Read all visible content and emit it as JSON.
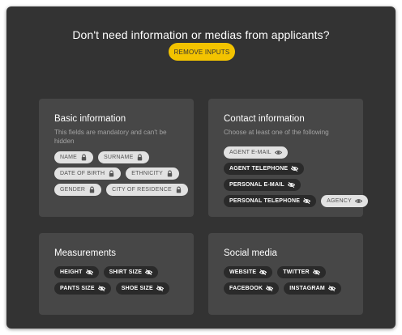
{
  "header": {
    "title": "Don't need information or medias from applicants?",
    "remove_button": "REMOVE INPUTS"
  },
  "colors": {
    "window_bg": "#333333",
    "card_bg": "#474747",
    "accent": "#f3c300",
    "chip_light": "#e2e2e2",
    "chip_dark": "#2a2a2a"
  },
  "basic": {
    "title": "Basic information",
    "subtitle_line1": "This fields are mandatory and can't be",
    "subtitle_line2": "hidden",
    "chips": [
      {
        "label": "NAME",
        "icon": "lock-icon"
      },
      {
        "label": "SURNAME",
        "icon": "lock-icon"
      },
      {
        "label": "DATE OF BIRTH",
        "icon": "lock-icon"
      },
      {
        "label": "ETHNICITY",
        "icon": "lock-icon"
      },
      {
        "label": "GENDER",
        "icon": "lock-icon"
      },
      {
        "label": "CITY OF RESIDENCE",
        "icon": "lock-icon"
      }
    ]
  },
  "contact": {
    "title": "Contact information",
    "subtitle": "Choose at least one of the following",
    "chips": [
      {
        "label": "AGENT E-MAIL",
        "icon": "eye-icon"
      },
      {
        "label": "AGENT TELEPHONE",
        "icon": "eye-slash-icon"
      },
      {
        "label": "PERSONAL E-MAIL",
        "icon": "eye-slash-icon"
      },
      {
        "label": "PERSONAL TELEPHONE",
        "icon": "eye-slash-icon"
      },
      {
        "label": "AGENCY",
        "icon": "eye-icon"
      }
    ]
  },
  "measurements": {
    "title": "Measurements",
    "chips": [
      {
        "label": "HEIGHT",
        "icon": "eye-slash-icon"
      },
      {
        "label": "SHIRT SIZE",
        "icon": "eye-slash-icon"
      },
      {
        "label": "PANTS SIZE",
        "icon": "eye-slash-icon"
      },
      {
        "label": "SHOE SIZE",
        "icon": "eye-slash-icon"
      }
    ]
  },
  "social": {
    "title": "Social media",
    "chips": [
      {
        "label": "WEBSITE",
        "icon": "eye-slash-icon"
      },
      {
        "label": "TWITTER",
        "icon": "eye-slash-icon"
      },
      {
        "label": "FACEBOOK",
        "icon": "eye-slash-icon"
      },
      {
        "label": "INSTAGRAM",
        "icon": "eye-slash-icon"
      }
    ]
  }
}
